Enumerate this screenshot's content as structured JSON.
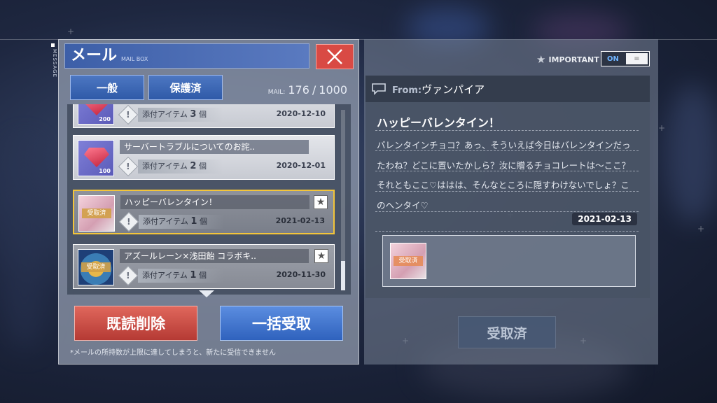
{
  "side_label": "MESSAGE",
  "header": {
    "title": "メール",
    "subtitle": "MAIL BOX",
    "close_icon": "close-icon"
  },
  "tabs": [
    {
      "label": "一般"
    },
    {
      "label": "保護済"
    }
  ],
  "mail_count": {
    "label": "MAIL:",
    "current": "176",
    "max": "1000"
  },
  "mails": [
    {
      "subject": "",
      "attach_text": "添付アイテム",
      "attach_count": "3",
      "attach_unit": "個",
      "date": "2020-12-10",
      "thumb_qty": "200",
      "thumb": "gem"
    },
    {
      "subject": "サーバートラブルについてのお詫..",
      "attach_text": "添付アイテム",
      "attach_count": "2",
      "attach_unit": "個",
      "date": "2020-12-01",
      "thumb_qty": "100",
      "thumb": "gem"
    },
    {
      "subject": "ハッピーバレンタイン！",
      "attach_text": "添付アイテム",
      "attach_count": "1",
      "attach_unit": "個",
      "date": "2021-02-13",
      "badge": "受取済",
      "thumb": "girl",
      "starred": true,
      "selected": true
    },
    {
      "subject": "アズールレーン×浅田飴 コラボキ..",
      "attach_text": "添付アイテム",
      "attach_count": "1",
      "attach_unit": "個",
      "date": "2020-11-30",
      "badge": "受取済",
      "thumb": "ball",
      "starred": true
    }
  ],
  "buttons": {
    "delete_read": "既読削除",
    "claim_all": "一括受取"
  },
  "footer_note": "*メールの所持数が上限に達してしまうと、新たに受信できません",
  "important": {
    "label": "IMPORTANT",
    "toggle": "ON",
    "knob": "≡"
  },
  "detail": {
    "from_label": "From:",
    "from_name": "ヴァンパイア",
    "title": "ハッピーバレンタイン！",
    "body": "バレンタインチョコ？あっ、そういえば今日はバレンタインだったわね？どこに置いたかしら？汝に贈るチョコレートは〜ここ？それともここ♡ははは、そんなところに隠すわけないでしょ？このヘンタイ♡",
    "date": "2021-02-13",
    "attachment_badge": "受取済",
    "claimed_button": "受取済"
  },
  "colors": {
    "accent_blue": "#2f62bd",
    "accent_red": "#b53a34",
    "selected_border": "#f3c53a"
  }
}
